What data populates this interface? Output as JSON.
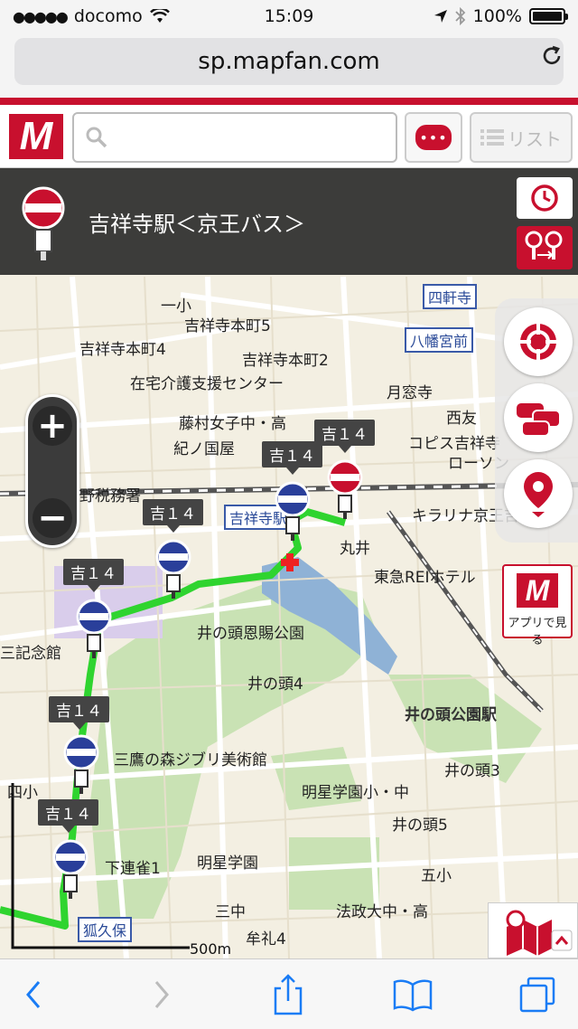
{
  "status": {
    "carrier": "docomo",
    "time": "15:09",
    "battery": "100%"
  },
  "browser": {
    "url": "sp.mapfan.com"
  },
  "app": {
    "logo": "M",
    "search_placeholder": "",
    "list_label": "リスト"
  },
  "station": {
    "title": "吉祥寺駅＜京王バス＞"
  },
  "map": {
    "labels": [
      "四軒寺",
      "八幡宮前",
      "吉祥寺本町5",
      "吉祥寺本町4",
      "吉祥寺本町2",
      "在宅介護支援センター",
      "月窓寺",
      "西友",
      "藤村女子中・高",
      "紀ノ国屋",
      "コピス吉祥寺",
      "ローソン",
      "野税務署",
      "吉祥寺駅",
      "キラリナ京王吉祥寺",
      "丸井",
      "東急REIホテル",
      "井の頭恩賜公園",
      "井の頭4",
      "井の頭公園駅",
      "三鷹の森ジブリ美術館",
      "井の頭3",
      "明星学園小・中",
      "井の頭5",
      "下連雀1",
      "明星学園",
      "五小",
      "三中",
      "牟礼4",
      "法政大中・高",
      "狐久保",
      "一小",
      "四小",
      "三記念館"
    ],
    "stop_callout": "吉１４",
    "scale": "500m"
  },
  "controls": {
    "app_open_label": "アプリで見る"
  },
  "icons": {
    "status": [
      "signal-dots-icon",
      "wifi-icon",
      "location-arrow-icon",
      "bluetooth-icon",
      "battery-icon"
    ],
    "reload": "reload-icon",
    "search": "search-icon",
    "chat": "chat-bubble-icon",
    "list": "list-icon",
    "clock": "clock-icon",
    "transfer": "transfer-icon",
    "crosshair": "crosshair-icon",
    "traffic": "traffic-icon",
    "pin": "pin-icon",
    "layers": "layers-icon"
  }
}
